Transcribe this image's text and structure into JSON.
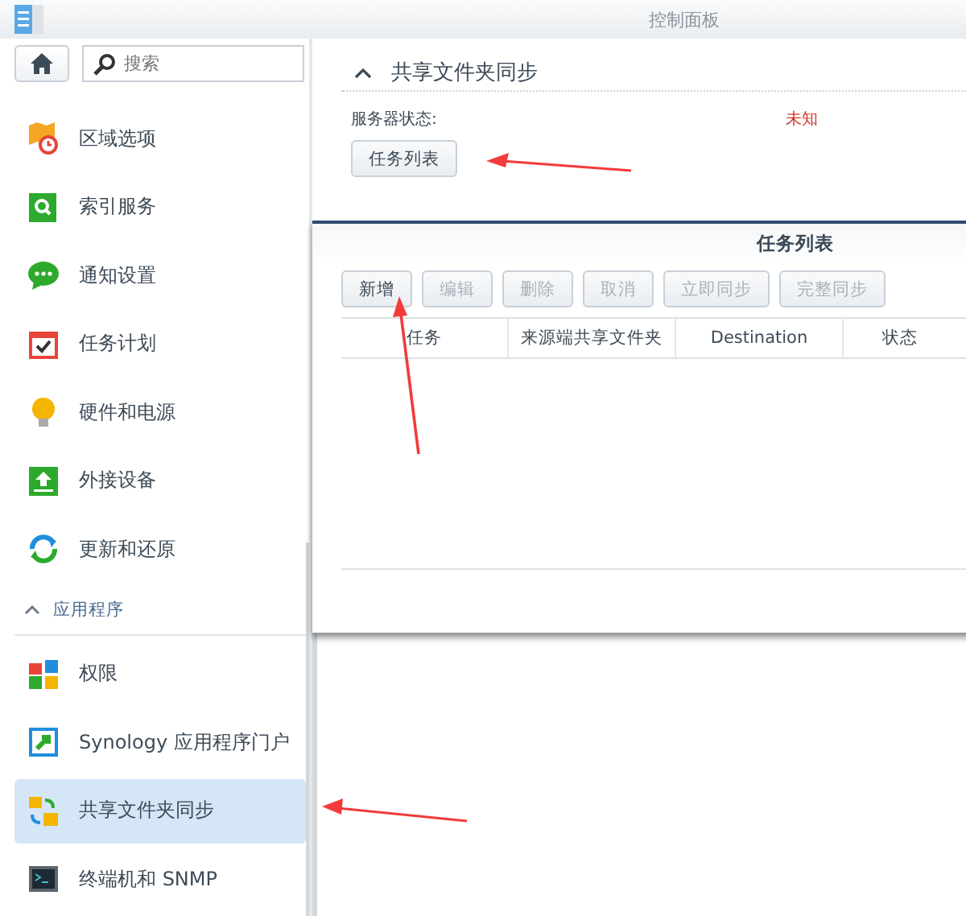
{
  "window": {
    "title": "控制面板"
  },
  "search": {
    "placeholder": "搜索"
  },
  "sidebar": {
    "items": [
      {
        "label": "区域选项",
        "selected": false
      },
      {
        "label": "索引服务",
        "selected": false
      },
      {
        "label": "通知设置",
        "selected": false
      },
      {
        "label": "任务计划",
        "selected": false
      },
      {
        "label": "硬件和电源",
        "selected": false
      },
      {
        "label": "外接设备",
        "selected": false
      },
      {
        "label": "更新和还原",
        "selected": false
      }
    ],
    "section": {
      "label": "应用程序",
      "expanded": true
    },
    "section_items": [
      {
        "label": "权限",
        "selected": false
      },
      {
        "label": "Synology 应用程序门户",
        "selected": false
      },
      {
        "label": "共享文件夹同步",
        "selected": true
      },
      {
        "label": "终端机和 SNMP",
        "selected": false
      }
    ]
  },
  "panel": {
    "title": "共享文件夹同步",
    "expanded": true,
    "status_label": "服务器状态:",
    "status_value": "未知",
    "button": "任务列表"
  },
  "dialog": {
    "title": "任务列表",
    "buttons": [
      {
        "label": "新增",
        "disabled": false
      },
      {
        "label": "编辑",
        "disabled": true
      },
      {
        "label": "删除",
        "disabled": true
      },
      {
        "label": "取消",
        "disabled": true
      },
      {
        "label": "立即同步",
        "disabled": true
      },
      {
        "label": "完整同步",
        "disabled": true
      }
    ],
    "columns": [
      "任务",
      "来源端共享文件夹",
      "Destination",
      "状态"
    ]
  }
}
